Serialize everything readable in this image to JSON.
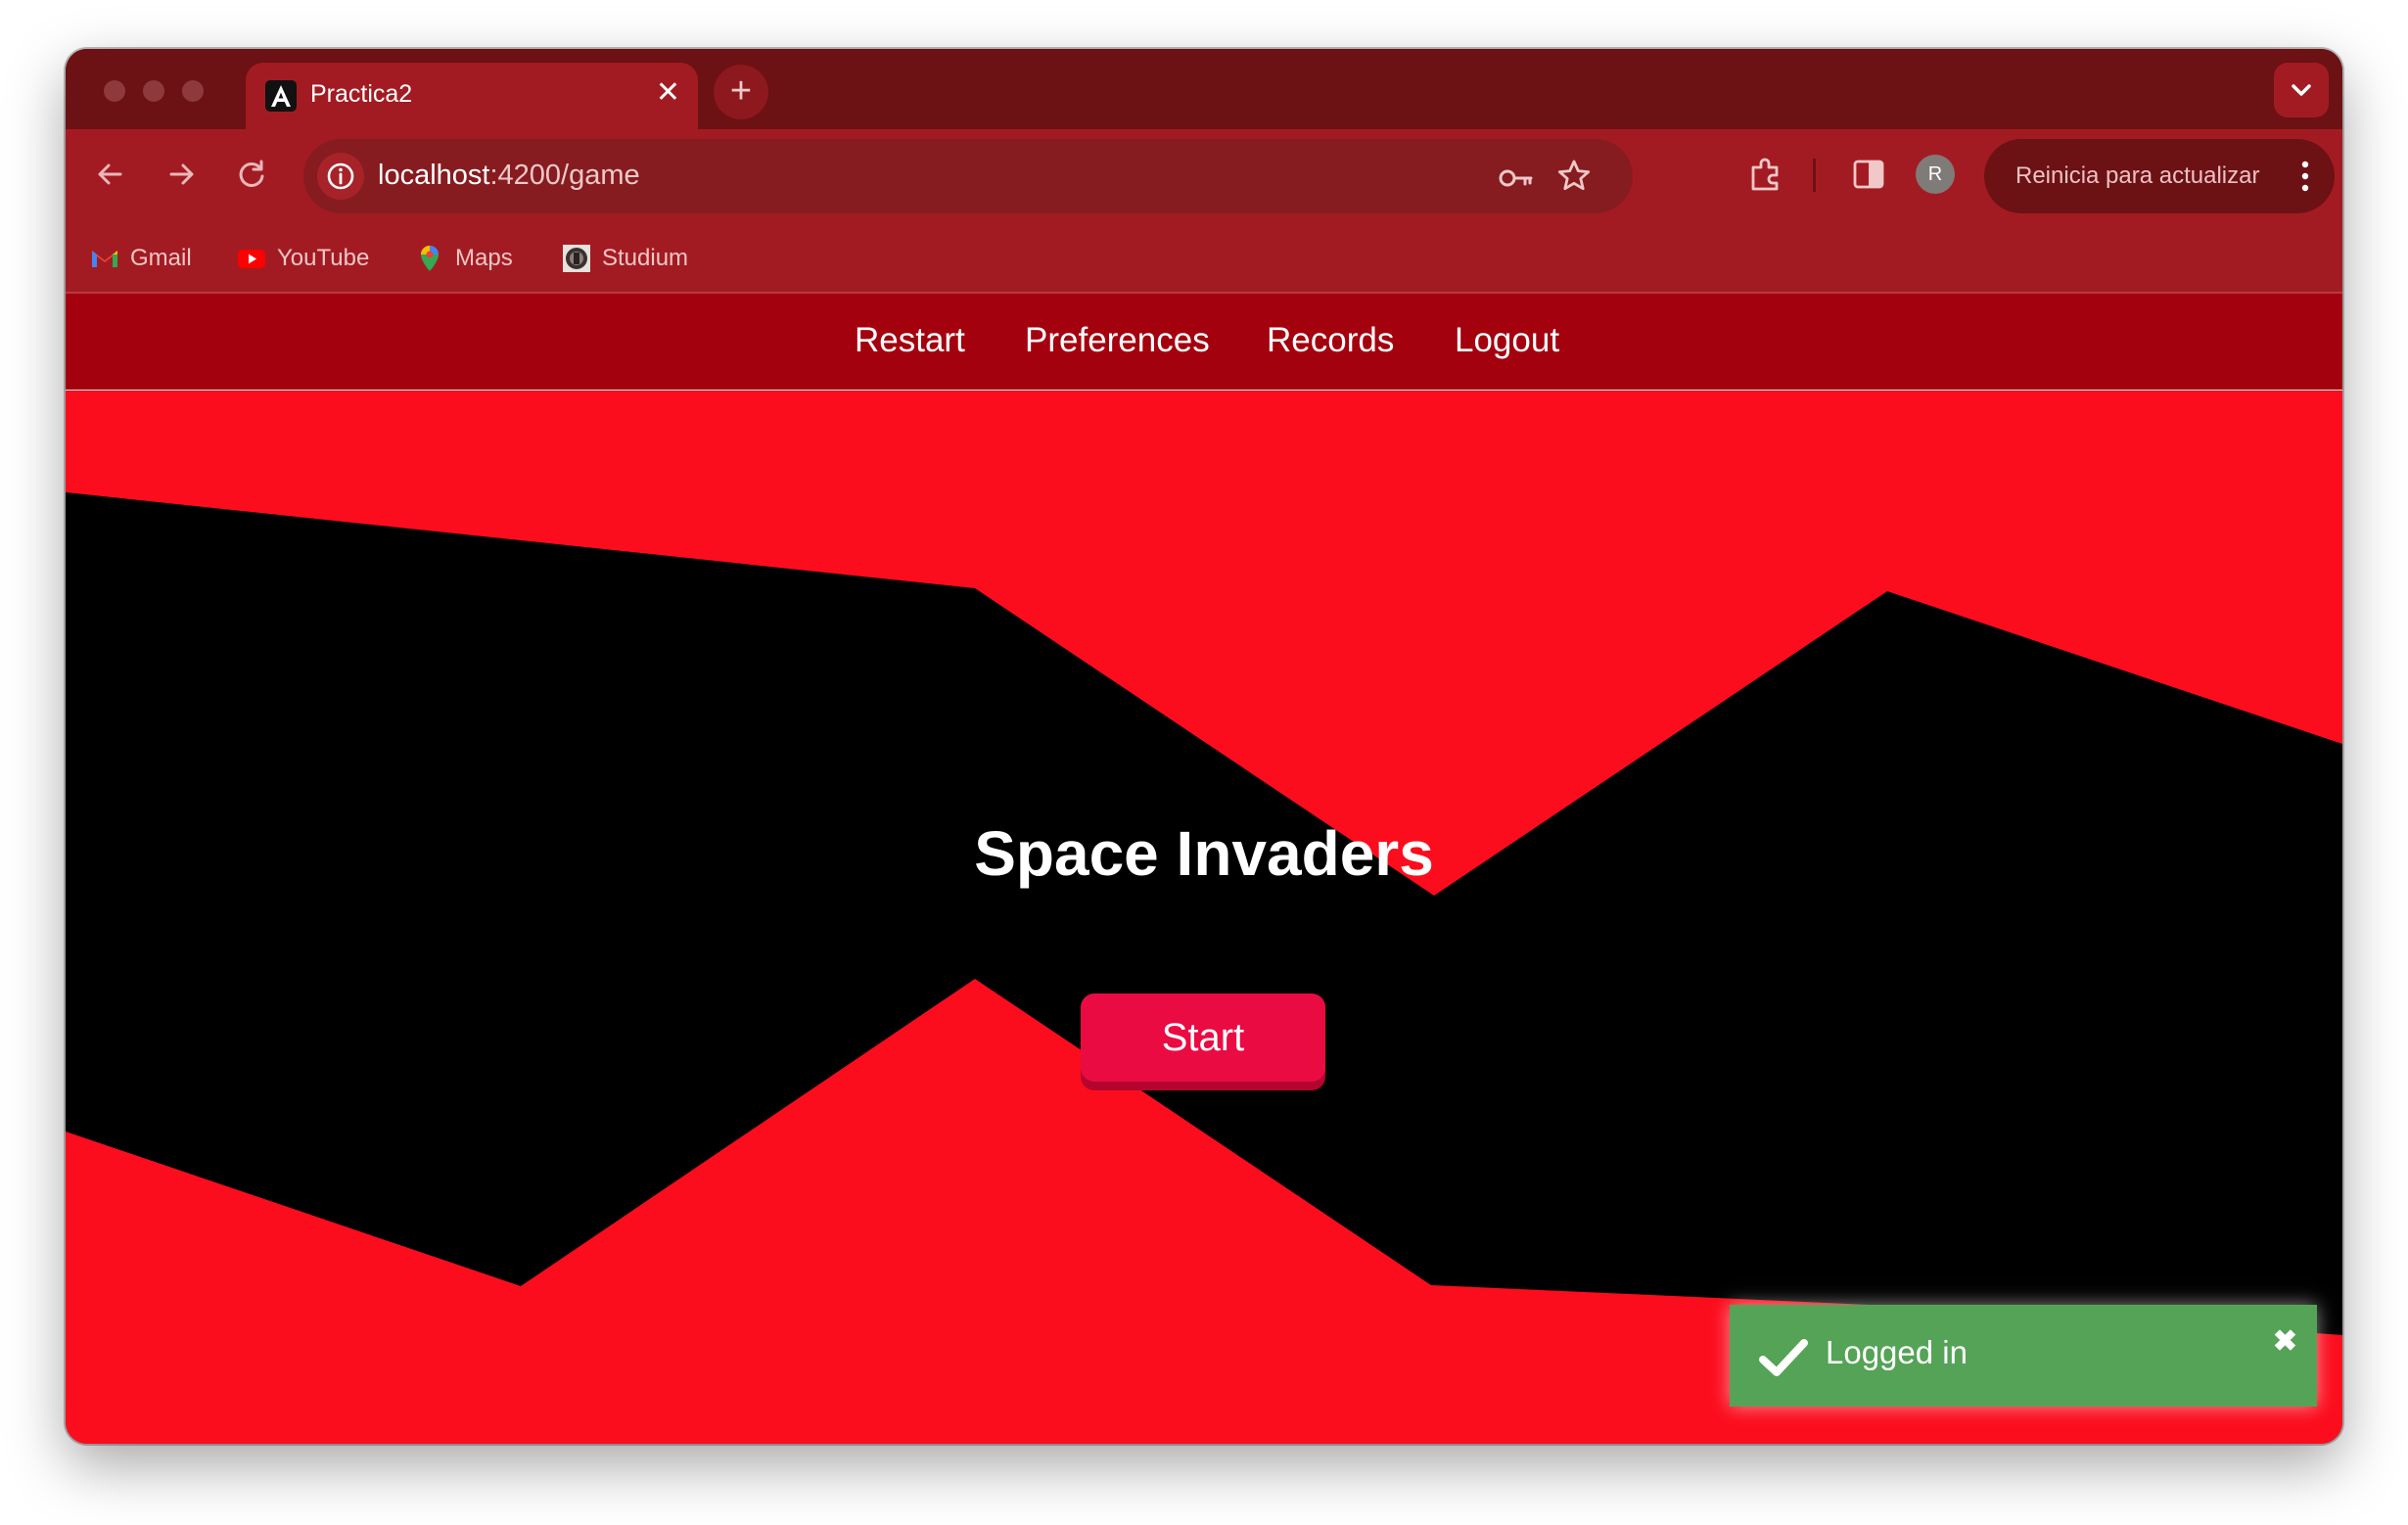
{
  "browser": {
    "tab": {
      "title": "Practica2",
      "close": "✕"
    },
    "new_tab": "+",
    "url_host": "localhost",
    "url_path": ":4200/game",
    "avatar_initial": "R",
    "update_label": "Reinicia para actualizar",
    "bookmarks": [
      {
        "label": "Gmail",
        "icon": "gmail-icon"
      },
      {
        "label": "YouTube",
        "icon": "youtube-icon"
      },
      {
        "label": "Maps",
        "icon": "maps-icon"
      },
      {
        "label": "Studium",
        "icon": "studium-icon"
      }
    ]
  },
  "nav": {
    "items": [
      "Restart",
      "Preferences",
      "Records",
      "Logout"
    ]
  },
  "game": {
    "title": "Space Invaders",
    "start_label": "Start"
  },
  "toast": {
    "message": "Logged in",
    "close": "✖"
  },
  "colors": {
    "browser_frame": "#6c1114",
    "browser_toolbar": "#a31b22",
    "app_nav": "#a4010f",
    "game_red": "#fb0d1d",
    "game_black": "#000000",
    "start_button": "#ea0b43",
    "toast_success": "#54a356"
  }
}
